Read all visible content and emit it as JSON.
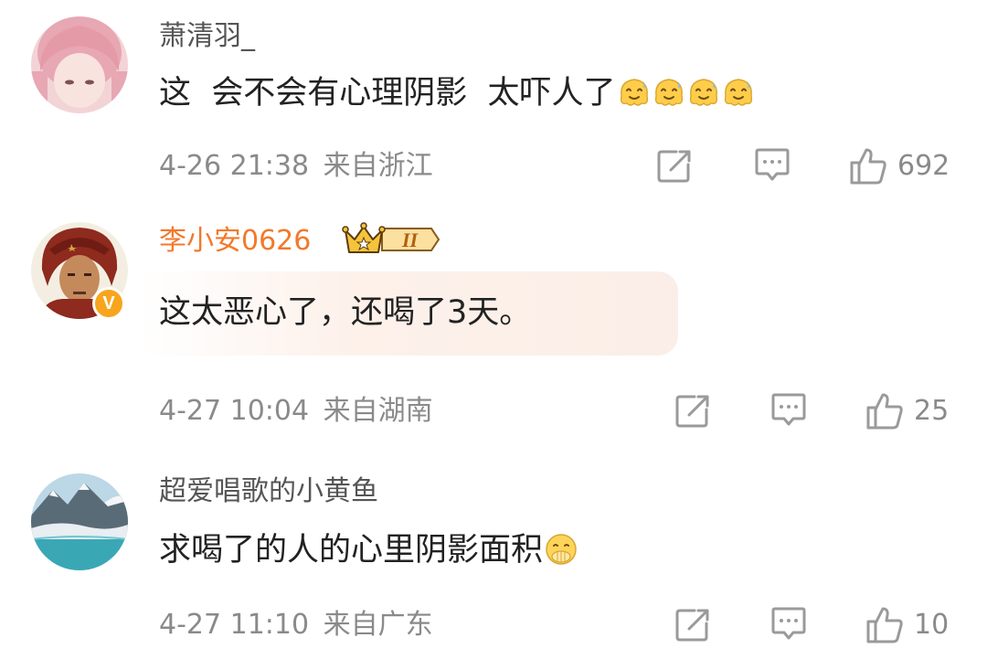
{
  "comments": [
    {
      "username": "萧清羽_",
      "text": "这  会不会有心理阴影  太吓人了",
      "emoji_count": 4,
      "emoji": "sweating-melting-face-emoji",
      "time": "4-26 21:38",
      "location": "来自浙江",
      "likes": "692"
    },
    {
      "username": "李小安0626",
      "badge_level": "II",
      "verified_mark": "V",
      "text": "这太恶心了，还喝了3天。",
      "time": "4-27 10:04",
      "location": "来自湖南",
      "likes": "25"
    },
    {
      "username": "超爱唱歌的小黄鱼",
      "text": "求喝了的人的心里阴影面积",
      "emoji": "hand-over-mouth-face-emoji",
      "time": "4-27 11:10",
      "location": "来自广东",
      "likes": "10"
    }
  ],
  "colors": {
    "vip_name": "#f2792b",
    "meta_gray": "#8a8a8a",
    "icon_gray": "#9a9a9a",
    "bubble_bg": "#fbeee8"
  },
  "icons": {
    "share": "share-icon",
    "reply": "comment-icon",
    "like": "thumbs-up-icon"
  }
}
